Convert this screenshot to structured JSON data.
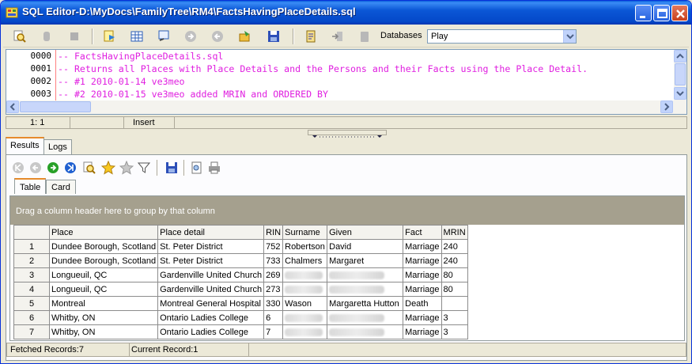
{
  "window": {
    "title": "SQL Editor-D:\\MyDocs\\FamilyTree\\RM4\\FactsHavingPlaceDetails.sql"
  },
  "toolbar": {
    "databases_label": "Databases",
    "database_selected": "Play"
  },
  "editor": {
    "line_numbers": [
      "0000",
      "0001",
      "0002",
      "0003"
    ],
    "lines": [
      "-- FactsHavingPlaceDetails.sql",
      "-- Returns all Places with Place Details and the Persons and their Facts using the Place Detail.",
      "-- #1 2010-01-14 ve3meo",
      "-- #2 2010-01-15 ve3meo added MRIN and ORDERED BY"
    ],
    "status": {
      "position": "1:  1",
      "mode": "Insert"
    }
  },
  "tabs": {
    "results": "Results",
    "logs": "Logs"
  },
  "subtabs": {
    "table": "Table",
    "card": "Card"
  },
  "grid": {
    "group_hint": "Drag a column header here to group by that column",
    "columns": [
      "Place",
      "Place detail",
      "RIN",
      "Surname",
      "Given",
      "Fact",
      "MRIN"
    ],
    "rows": [
      {
        "n": "1",
        "place": "Dundee Borough, Scotland",
        "detail": "St. Peter District",
        "rin": "752",
        "surname": "Robertson",
        "given": "David",
        "fact": "Marriage",
        "mrin": "240"
      },
      {
        "n": "2",
        "place": "Dundee Borough, Scotland",
        "detail": "St. Peter District",
        "rin": "733",
        "surname": "Chalmers",
        "given": "Margaret",
        "fact": "Marriage",
        "mrin": "240"
      },
      {
        "n": "3",
        "place": "Longueuil, QC",
        "detail": "Gardenville United Church",
        "rin": "269",
        "surname": "",
        "given": "",
        "fact": "Marriage",
        "mrin": "80"
      },
      {
        "n": "4",
        "place": "Longueuil, QC",
        "detail": "Gardenville United Church",
        "rin": "273",
        "surname": "",
        "given": "",
        "fact": "Marriage",
        "mrin": "80"
      },
      {
        "n": "5",
        "place": "Montreal",
        "detail": "Montreal General Hospital",
        "rin": "330",
        "surname": "Wason",
        "given": "Margaretta Hutton",
        "fact": "Death",
        "mrin": ""
      },
      {
        "n": "6",
        "place": "Whitby, ON",
        "detail": "Ontario Ladies College",
        "rin": "6",
        "surname": "",
        "given": "",
        "fact": "Marriage",
        "mrin": "3"
      },
      {
        "n": "7",
        "place": "Whitby, ON",
        "detail": "Ontario Ladies College",
        "rin": "7",
        "surname": "",
        "given": "",
        "fact": "Marriage",
        "mrin": "3"
      }
    ]
  },
  "statusbar": {
    "fetched": "Fetched Records:7",
    "current": "Current Record:1"
  },
  "colors": {
    "title_bar": "#0b57d6",
    "comment": "#e020e0",
    "group_bar": "#a5a08e",
    "window_bg": "#ece9d8"
  }
}
